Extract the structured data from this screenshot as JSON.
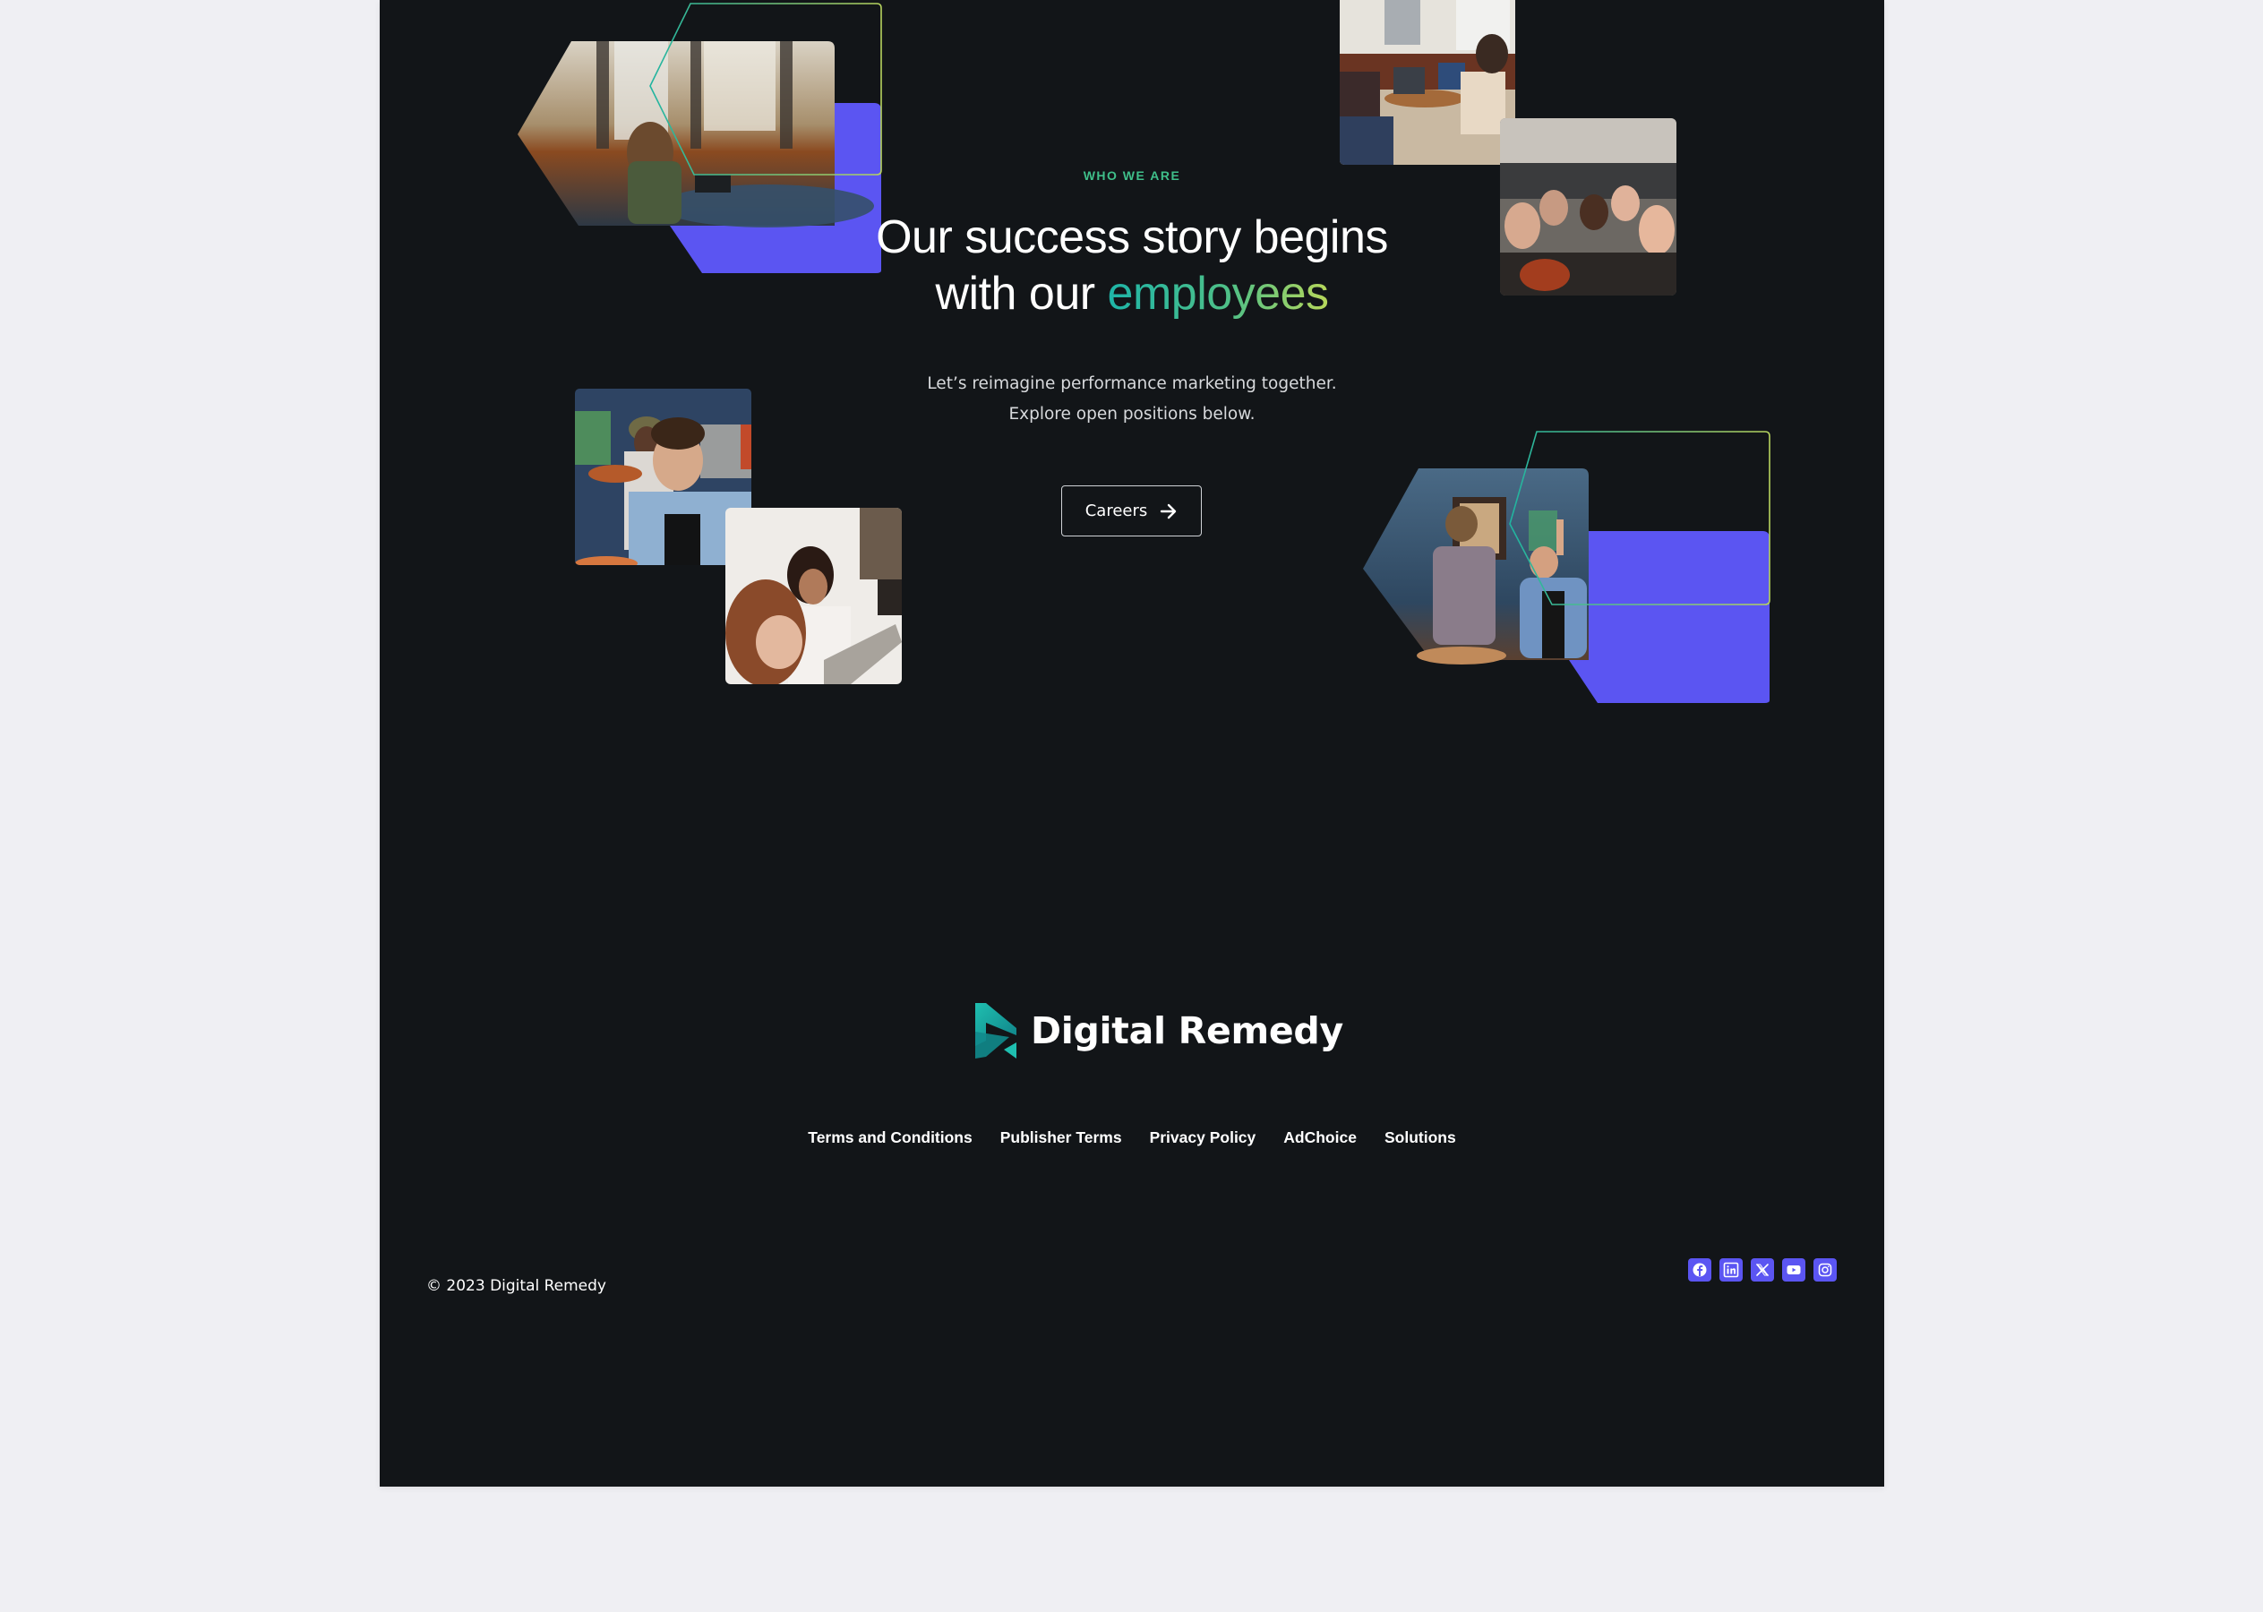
{
  "colors": {
    "panel_bg": "#121518",
    "page_bg": "#efeff3",
    "accent_purple": "#5b55f2",
    "accent_green": "#3fbf8a",
    "gradient_start": "#1eb5a8",
    "gradient_end": "#b8d85a"
  },
  "hero": {
    "eyebrow": "WHO WE ARE",
    "headline_line1": "Our success story begins",
    "headline_line2_prefix": "with our ",
    "headline_highlight": "employees",
    "subtitle_line1": "Let’s reimagine performance marketing together.",
    "subtitle_line2": "Explore open positions below.",
    "cta_label": "Careers",
    "cta_icon": "arrow-right-icon"
  },
  "photos": [
    {
      "name": "photo-woman-laptop-lounge",
      "description": "Woman working on laptop in office lounge"
    },
    {
      "name": "photo-two-women-laptops",
      "description": "Two women working on laptops at a table"
    },
    {
      "name": "photo-group-selfie",
      "description": "Group of coworkers taking a selfie"
    },
    {
      "name": "photo-woman-smiling-food",
      "description": "Smiling woman holding food at a party"
    },
    {
      "name": "photo-two-women-reading",
      "description": "Two women looking at a laptop"
    },
    {
      "name": "photo-party-peace-sign",
      "description": "Coworkers at a party, one making a peace sign"
    }
  ],
  "footer": {
    "brand": "Digital Remedy",
    "links": [
      "Terms and Conditions",
      "Publisher Terms",
      "Privacy Policy",
      "AdChoice",
      "Solutions"
    ],
    "copyright": "© 2023 Digital Remedy",
    "social": [
      {
        "name": "facebook-icon",
        "label": "Facebook"
      },
      {
        "name": "linkedin-icon",
        "label": "LinkedIn"
      },
      {
        "name": "x-twitter-icon",
        "label": "X"
      },
      {
        "name": "youtube-icon",
        "label": "YouTube"
      },
      {
        "name": "instagram-icon",
        "label": "Instagram"
      }
    ]
  }
}
